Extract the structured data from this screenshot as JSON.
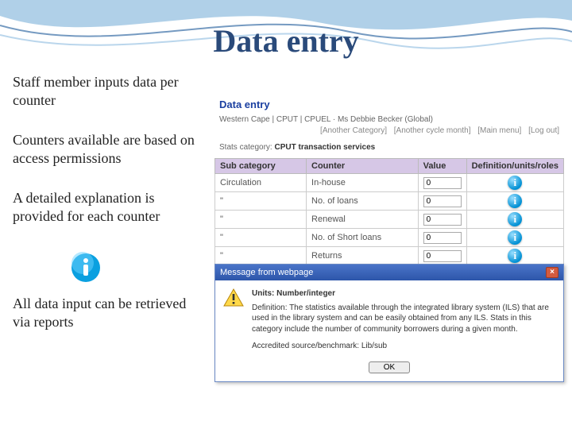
{
  "slide": {
    "title": "Data entry",
    "bullets": [
      "Staff member inputs data per counter",
      "Counters available are based on access permissions",
      "A detailed explanation is provided for each counter",
      "All data input can be retrieved via reports"
    ]
  },
  "panel": {
    "heading": "Data entry",
    "breadcrumb": "Western Cape | CPUT | CPUEL · Ms Debbie Becker  (Global)",
    "links": [
      "[Another Category]",
      "[Another cycle month]",
      "[Main menu]",
      "[Log out]"
    ],
    "stats_label": "Stats category:",
    "stats_value": "CPUT transaction services",
    "columns": [
      "Sub category",
      "Counter",
      "Value",
      "Definition/units/roles"
    ],
    "rows": [
      {
        "sub": "Circulation",
        "counter": "In-house",
        "value": "0"
      },
      {
        "sub": "\"",
        "counter": "No. of loans",
        "value": "0"
      },
      {
        "sub": "\"",
        "counter": "Renewal",
        "value": "0"
      },
      {
        "sub": "\"",
        "counter": "No. of Short loans",
        "value": "0"
      },
      {
        "sub": "\"",
        "counter": "Returns",
        "value": "0"
      }
    ]
  },
  "dialog": {
    "title": "Message from webpage",
    "heading": "Units: Number/integer",
    "body": "Definition: The statistics available through the integrated library system (ILS) that are used in the library system and can be easily obtained from any ILS. Stats in this category include the number of community borrowers during a given month.",
    "sub": "Accredited source/benchmark: Lib/sub",
    "ok": "OK"
  }
}
